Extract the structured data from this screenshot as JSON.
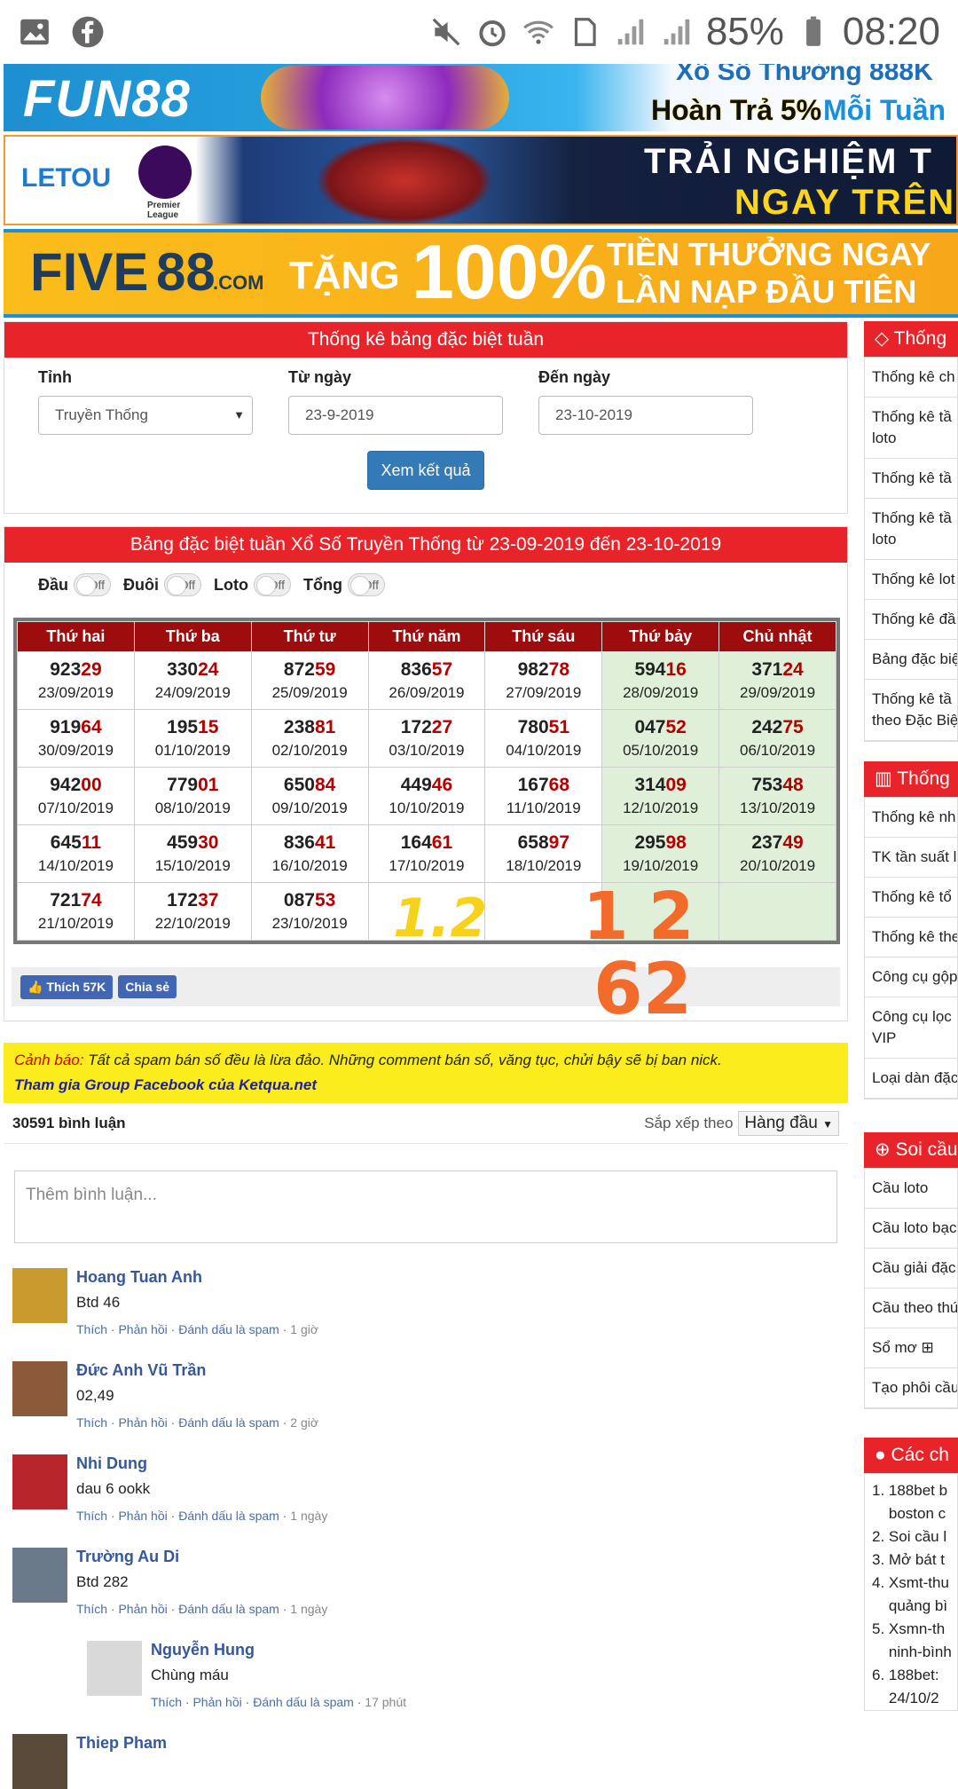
{
  "status_bar": {
    "battery": "85%",
    "time": "08:20"
  },
  "banners": {
    "fun88": {
      "brand": "FUN88",
      "line1": "Xổ Số Thưởng 888K",
      "line2a": "Hoàn Trả 5%",
      "line2b": "Mỗi Tuần"
    },
    "letou": {
      "brand": "LETOU",
      "league": "Premier League",
      "line1": "TRẢI NGHIỆM T",
      "line2": "NGAY TRÊN"
    },
    "five88": {
      "brand1": "FIVE",
      "brand2": "88",
      "brand3": ".COM",
      "tang": "TẶNG",
      "pct": "100%",
      "line1": "TIỀN THƯỞNG NGAY",
      "line2": "LẦN NẠP ĐẦU TIÊN"
    }
  },
  "filter": {
    "title": "Thống kê bảng đặc biệt tuần",
    "province_label": "Tỉnh",
    "province_value": "Truyền Thống",
    "from_label": "Từ ngày",
    "from_value": "23-9-2019",
    "to_label": "Đến ngày",
    "to_value": "23-10-2019",
    "submit": "Xem kết quả"
  },
  "table": {
    "title": "Bảng đặc biệt tuần Xổ Số Truyền Thống từ 23-09-2019 đến 23-10-2019",
    "toggles": [
      {
        "label": "Đầu",
        "state": "Off"
      },
      {
        "label": "Đuôi",
        "state": "Off"
      },
      {
        "label": "Loto",
        "state": "Off"
      },
      {
        "label": "Tổng",
        "state": "Off"
      }
    ],
    "headers": [
      "Thứ hai",
      "Thứ ba",
      "Thứ tư",
      "Thứ năm",
      "Thứ sáu",
      "Thứ bảy",
      "Chủ nhật"
    ],
    "rows": [
      [
        {
          "a": "923",
          "b": "29",
          "d": "23/09/2019"
        },
        {
          "a": "330",
          "b": "24",
          "d": "24/09/2019"
        },
        {
          "a": "872",
          "b": "59",
          "d": "25/09/2019"
        },
        {
          "a": "836",
          "b": "57",
          "d": "26/09/2019"
        },
        {
          "a": "982",
          "b": "78",
          "d": "27/09/2019"
        },
        {
          "a": "594",
          "b": "16",
          "d": "28/09/2019"
        },
        {
          "a": "371",
          "b": "24",
          "d": "29/09/2019"
        }
      ],
      [
        {
          "a": "919",
          "b": "64",
          "d": "30/09/2019"
        },
        {
          "a": "195",
          "b": "15",
          "d": "01/10/2019"
        },
        {
          "a": "238",
          "b": "81",
          "d": "02/10/2019"
        },
        {
          "a": "172",
          "b": "27",
          "d": "03/10/2019"
        },
        {
          "a": "780",
          "b": "51",
          "d": "04/10/2019"
        },
        {
          "a": "047",
          "b": "52",
          "d": "05/10/2019"
        },
        {
          "a": "242",
          "b": "75",
          "d": "06/10/2019"
        }
      ],
      [
        {
          "a": "942",
          "b": "00",
          "d": "07/10/2019"
        },
        {
          "a": "779",
          "b": "01",
          "d": "08/10/2019"
        },
        {
          "a": "650",
          "b": "84",
          "d": "09/10/2019"
        },
        {
          "a": "449",
          "b": "46",
          "d": "10/10/2019"
        },
        {
          "a": "167",
          "b": "68",
          "d": "11/10/2019"
        },
        {
          "a": "314",
          "b": "09",
          "d": "12/10/2019"
        },
        {
          "a": "753",
          "b": "48",
          "d": "13/10/2019"
        }
      ],
      [
        {
          "a": "645",
          "b": "11",
          "d": "14/10/2019"
        },
        {
          "a": "459",
          "b": "30",
          "d": "15/10/2019"
        },
        {
          "a": "836",
          "b": "41",
          "d": "16/10/2019"
        },
        {
          "a": "164",
          "b": "61",
          "d": "17/10/2019"
        },
        {
          "a": "658",
          "b": "97",
          "d": "18/10/2019"
        },
        {
          "a": "295",
          "b": "98",
          "d": "19/10/2019"
        },
        {
          "a": "237",
          "b": "49",
          "d": "20/10/2019"
        }
      ],
      [
        {
          "a": "721",
          "b": "74",
          "d": "21/10/2019"
        },
        {
          "a": "172",
          "b": "37",
          "d": "22/10/2019"
        },
        {
          "a": "087",
          "b": "53",
          "d": "23/10/2019"
        },
        {
          "a": "",
          "b": "",
          "d": ""
        },
        {
          "a": "",
          "b": "",
          "d": ""
        },
        {
          "a": "",
          "b": "",
          "d": ""
        },
        {
          "a": "",
          "b": "",
          "d": ""
        }
      ]
    ],
    "handwriting": {
      "yellow": "1.2",
      "orange_top": "1",
      "orange_mid": "2",
      "orange_bottom": "62"
    }
  },
  "social": {
    "like": "Thích",
    "like_count": "57K",
    "share": "Chia sẻ"
  },
  "warning": {
    "label": "Cảnh báo:",
    "text": " Tất cả spam bán số đều là lừa đảo. Những comment bán số, văng tục, chửi bậy sẽ bị ban nick.",
    "link": "Tham gia Group Facebook của Ketqua.net"
  },
  "comments": {
    "count": "30591 bình luận",
    "sort_label": "Sắp xếp theo",
    "sort_value": "Hàng đầu",
    "placeholder": "Thêm bình luận...",
    "action_like": "Thích",
    "action_reply": "Phản hồi",
    "action_spam": "Đánh dấu là spam",
    "items": [
      {
        "name": "Hoang Tuan Anh",
        "text": "Btd 46",
        "time": "1 giờ",
        "color": "#c99a2e"
      },
      {
        "name": "Đức Anh Vũ Trần",
        "text": "02,49",
        "time": "2 giờ",
        "color": "#8a5a3b"
      },
      {
        "name": "Nhi Dung",
        "text": "dau 6 ookk",
        "time": "1 ngày",
        "color": "#b8252a"
      },
      {
        "name": "Trường Au Di",
        "text": "Btd 282",
        "time": "1 ngày",
        "color": "#6b7a8a"
      },
      {
        "name": "Nguyễn Hung",
        "text": "Chùng máu",
        "time": "17 phút",
        "color": "#d9d9d9"
      },
      {
        "name": "Thiep Pham",
        "text": "",
        "time": "",
        "color": "#5a4a3a"
      }
    ]
  },
  "sidebar": {
    "sec1": {
      "title": "Thống",
      "items": [
        "Thống kê ch",
        "Thống kê tầ\nloto",
        "Thống kê tầ",
        "Thống kê tầ\nloto",
        "Thống kê lot",
        "Thống kê đầ",
        "Bảng đặc biệ",
        "Thống kê tầ\ntheo Đặc Biệ"
      ]
    },
    "sec2": {
      "title": "Thống",
      "items": [
        "Thống kê nh",
        "TK tần suất l",
        "Thống kê tổ",
        "Thống kê the",
        "Công cụ gộp",
        "Công cụ lọc\nVIP",
        "Loại dàn đặc"
      ]
    },
    "sec3": {
      "title": "Soi cầu",
      "items": [
        "Cầu loto",
        "Cầu loto bạc",
        "Cầu giải đặc",
        "Cầu theo thứ",
        "Sổ mơ ⊞",
        "Tạo phôi cầu"
      ]
    },
    "sec4": {
      "title": "Các ch",
      "items": [
        "1. 188bet b",
        "    boston c",
        "2. Soi cầu l",
        "3. Mở bát t",
        "4. Xsmt-thu",
        "    quảng bì",
        "5. Xsmn-th",
        "    ninh-bình",
        "6. 188bet:",
        "    24/10/2"
      ]
    }
  }
}
